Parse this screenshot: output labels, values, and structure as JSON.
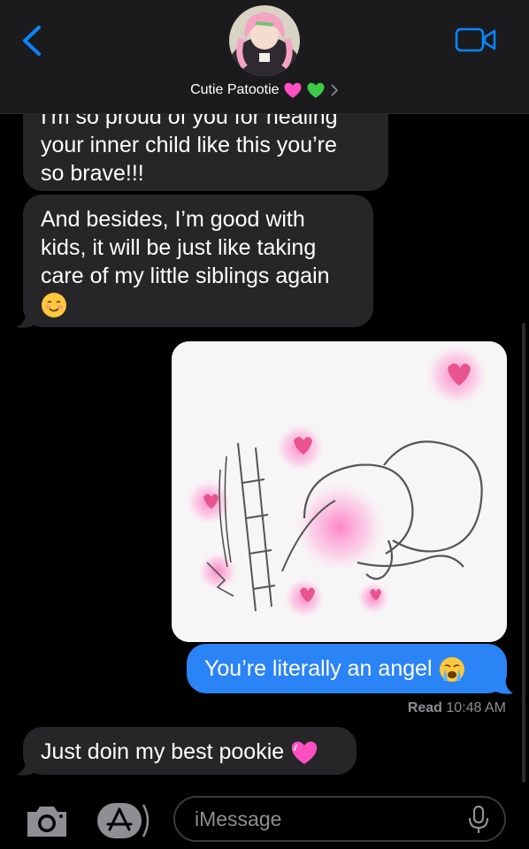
{
  "header": {
    "contact_name": "Cutie Patootie",
    "name_emojis": [
      "pink-heart",
      "green-heart"
    ]
  },
  "messages": [
    {
      "direction": "incoming",
      "lines": [
        "I'm so proud of you for healing",
        "your inner child like this you’re",
        "so brave!!!"
      ]
    },
    {
      "direction": "incoming",
      "lines": [
        "And besides, I’m good with",
        "kids, it will be just like taking",
        "care of my little siblings again"
      ],
      "emoji": "smiling-face-with-blush"
    },
    {
      "direction": "outgoing",
      "type": "image",
      "description": "sticker"
    },
    {
      "direction": "outgoing",
      "lines": [
        "You’re literally an angel"
      ],
      "emoji": "loudly-crying-face"
    },
    {
      "direction": "incoming",
      "lines": [
        "Just doin my best pookie"
      ],
      "emoji": "pink-heart"
    }
  ],
  "receipt": {
    "label": "Read",
    "time": "10:48 AM"
  },
  "input": {
    "placeholder": "iMessage"
  },
  "colors": {
    "outgoing": "#2b84f5",
    "incoming": "#262628",
    "accent": "#0a84ff"
  }
}
